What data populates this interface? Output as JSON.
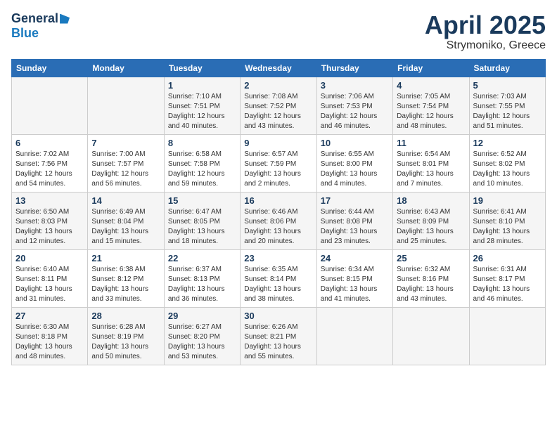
{
  "logo": {
    "general": "General",
    "blue": "Blue"
  },
  "title": "April 2025",
  "location": "Strymoniko, Greece",
  "days_of_week": [
    "Sunday",
    "Monday",
    "Tuesday",
    "Wednesday",
    "Thursday",
    "Friday",
    "Saturday"
  ],
  "weeks": [
    [
      {
        "day": "",
        "info": ""
      },
      {
        "day": "",
        "info": ""
      },
      {
        "day": "1",
        "info": "Sunrise: 7:10 AM\nSunset: 7:51 PM\nDaylight: 12 hours and 40 minutes."
      },
      {
        "day": "2",
        "info": "Sunrise: 7:08 AM\nSunset: 7:52 PM\nDaylight: 12 hours and 43 minutes."
      },
      {
        "day": "3",
        "info": "Sunrise: 7:06 AM\nSunset: 7:53 PM\nDaylight: 12 hours and 46 minutes."
      },
      {
        "day": "4",
        "info": "Sunrise: 7:05 AM\nSunset: 7:54 PM\nDaylight: 12 hours and 48 minutes."
      },
      {
        "day": "5",
        "info": "Sunrise: 7:03 AM\nSunset: 7:55 PM\nDaylight: 12 hours and 51 minutes."
      }
    ],
    [
      {
        "day": "6",
        "info": "Sunrise: 7:02 AM\nSunset: 7:56 PM\nDaylight: 12 hours and 54 minutes."
      },
      {
        "day": "7",
        "info": "Sunrise: 7:00 AM\nSunset: 7:57 PM\nDaylight: 12 hours and 56 minutes."
      },
      {
        "day": "8",
        "info": "Sunrise: 6:58 AM\nSunset: 7:58 PM\nDaylight: 12 hours and 59 minutes."
      },
      {
        "day": "9",
        "info": "Sunrise: 6:57 AM\nSunset: 7:59 PM\nDaylight: 13 hours and 2 minutes."
      },
      {
        "day": "10",
        "info": "Sunrise: 6:55 AM\nSunset: 8:00 PM\nDaylight: 13 hours and 4 minutes."
      },
      {
        "day": "11",
        "info": "Sunrise: 6:54 AM\nSunset: 8:01 PM\nDaylight: 13 hours and 7 minutes."
      },
      {
        "day": "12",
        "info": "Sunrise: 6:52 AM\nSunset: 8:02 PM\nDaylight: 13 hours and 10 minutes."
      }
    ],
    [
      {
        "day": "13",
        "info": "Sunrise: 6:50 AM\nSunset: 8:03 PM\nDaylight: 13 hours and 12 minutes."
      },
      {
        "day": "14",
        "info": "Sunrise: 6:49 AM\nSunset: 8:04 PM\nDaylight: 13 hours and 15 minutes."
      },
      {
        "day": "15",
        "info": "Sunrise: 6:47 AM\nSunset: 8:05 PM\nDaylight: 13 hours and 18 minutes."
      },
      {
        "day": "16",
        "info": "Sunrise: 6:46 AM\nSunset: 8:06 PM\nDaylight: 13 hours and 20 minutes."
      },
      {
        "day": "17",
        "info": "Sunrise: 6:44 AM\nSunset: 8:08 PM\nDaylight: 13 hours and 23 minutes."
      },
      {
        "day": "18",
        "info": "Sunrise: 6:43 AM\nSunset: 8:09 PM\nDaylight: 13 hours and 25 minutes."
      },
      {
        "day": "19",
        "info": "Sunrise: 6:41 AM\nSunset: 8:10 PM\nDaylight: 13 hours and 28 minutes."
      }
    ],
    [
      {
        "day": "20",
        "info": "Sunrise: 6:40 AM\nSunset: 8:11 PM\nDaylight: 13 hours and 31 minutes."
      },
      {
        "day": "21",
        "info": "Sunrise: 6:38 AM\nSunset: 8:12 PM\nDaylight: 13 hours and 33 minutes."
      },
      {
        "day": "22",
        "info": "Sunrise: 6:37 AM\nSunset: 8:13 PM\nDaylight: 13 hours and 36 minutes."
      },
      {
        "day": "23",
        "info": "Sunrise: 6:35 AM\nSunset: 8:14 PM\nDaylight: 13 hours and 38 minutes."
      },
      {
        "day": "24",
        "info": "Sunrise: 6:34 AM\nSunset: 8:15 PM\nDaylight: 13 hours and 41 minutes."
      },
      {
        "day": "25",
        "info": "Sunrise: 6:32 AM\nSunset: 8:16 PM\nDaylight: 13 hours and 43 minutes."
      },
      {
        "day": "26",
        "info": "Sunrise: 6:31 AM\nSunset: 8:17 PM\nDaylight: 13 hours and 46 minutes."
      }
    ],
    [
      {
        "day": "27",
        "info": "Sunrise: 6:30 AM\nSunset: 8:18 PM\nDaylight: 13 hours and 48 minutes."
      },
      {
        "day": "28",
        "info": "Sunrise: 6:28 AM\nSunset: 8:19 PM\nDaylight: 13 hours and 50 minutes."
      },
      {
        "day": "29",
        "info": "Sunrise: 6:27 AM\nSunset: 8:20 PM\nDaylight: 13 hours and 53 minutes."
      },
      {
        "day": "30",
        "info": "Sunrise: 6:26 AM\nSunset: 8:21 PM\nDaylight: 13 hours and 55 minutes."
      },
      {
        "day": "",
        "info": ""
      },
      {
        "day": "",
        "info": ""
      },
      {
        "day": "",
        "info": ""
      }
    ]
  ]
}
